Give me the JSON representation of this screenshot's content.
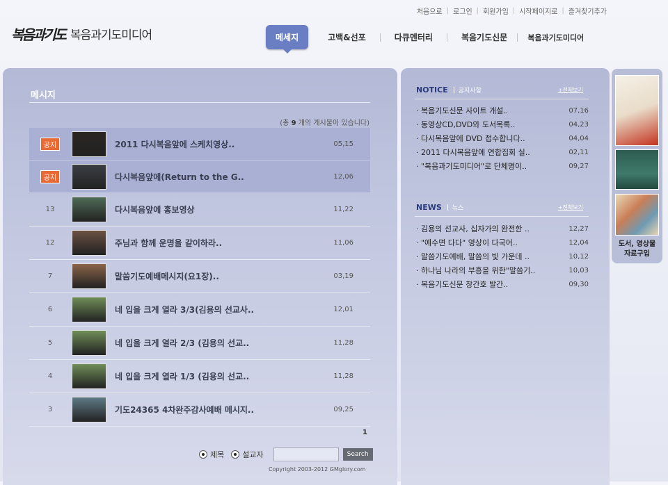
{
  "utility_nav": [
    "처음으로",
    "로그인",
    "회원가입",
    "시작페이지로",
    "즐겨찾기추가"
  ],
  "logo": {
    "mark": "복음과기도",
    "name": "복음과기도미디어"
  },
  "main_nav": {
    "active": "메세지",
    "items": [
      "고백&선포",
      "다큐멘터리",
      "복음기도신문",
      "복음과기도미디어"
    ]
  },
  "board": {
    "title": "메시지",
    "count_prefix": "(총",
    "count": "9",
    "count_suffix": "개의 게시물이 있습니다)",
    "rows": [
      {
        "num": "공지",
        "notice": true,
        "title": "2011 다시복음앞에 스케치영상..",
        "date": "05,15",
        "thumb_color": "#2a2622"
      },
      {
        "num": "공지",
        "notice": true,
        "title": "다시복음앞에(Return to the G..",
        "date": "12,06",
        "thumb_color": "#3b3f44"
      },
      {
        "num": "13",
        "notice": false,
        "title": "다시복음앞에 홍보영상",
        "date": "11,22",
        "thumb_color": "#4e6b57"
      },
      {
        "num": "12",
        "notice": false,
        "title": "주님과 함께 운명을 같이하라..",
        "date": "11,06",
        "thumb_color": "#6a5142"
      },
      {
        "num": "7",
        "notice": false,
        "title": "말씀기도예배메시지(요1장)..",
        "date": "03,19",
        "thumb_color": "#8a6449"
      },
      {
        "num": "6",
        "notice": false,
        "title": "네 입을 크게 열라 3/3(김용의 선교사..",
        "date": "12,01",
        "thumb_color": "#6f8d57"
      },
      {
        "num": "5",
        "notice": false,
        "title": "네 입을 크게 열라 2/3 (김용의 선교..",
        "date": "11,28",
        "thumb_color": "#6f8d57"
      },
      {
        "num": "4",
        "notice": false,
        "title": "네 입을 크게 열라 1/3 (김용의 선교..",
        "date": "11,28",
        "thumb_color": "#6f8d57"
      },
      {
        "num": "3",
        "notice": false,
        "title": "기도24365 4차완주감사예배 메시지..",
        "date": "09,25",
        "thumb_color": "#5f7a86"
      }
    ],
    "page": "1",
    "search": {
      "option_title": "제목",
      "option_preacher": "설교자",
      "button": "Search"
    },
    "copyright": "Copyright 2003-2012 GMglory.com"
  },
  "notice": {
    "title": "NOTICE",
    "subtitle": "공지사항",
    "more": "+전체보기",
    "items": [
      {
        "text": "· 복음기도신문 사이트 개설..",
        "date": "07,16"
      },
      {
        "text": "· 동영상CD,DVD와 도서목록..",
        "date": "04,23"
      },
      {
        "text": "· 다시복음앞에 DVD 접수합니다..",
        "date": "04,04"
      },
      {
        "text": "· 2011 다시복음앞에 연합집회 실..",
        "date": "02,11"
      },
      {
        "text": "· \"복음과기도미디어\"로 단체명이..",
        "date": "09,27"
      }
    ]
  },
  "news": {
    "title": "NEWS",
    "subtitle": "뉴스",
    "more": "+전체보기",
    "items": [
      {
        "text": "· 김용의 선교사, 십자가의 완전한 ..",
        "date": "12,27"
      },
      {
        "text": "· \"예수면 다다\" 영상이 다국어..",
        "date": "12,04"
      },
      {
        "text": "· 말씀기도예배, 말씀의 빛 가운데 ..",
        "date": "10,12"
      },
      {
        "text": "· 하나님 나라의 부흥을 위한\"말씀기..",
        "date": "10,03"
      },
      {
        "text": "· 복음기도신문 창간호 발간..",
        "date": "09,30"
      }
    ]
  },
  "side_banner": {
    "label_line1": "도서, 영상물",
    "label_line2": "자료구입"
  },
  "colors": {
    "nav_active": "#6a7ec4",
    "notice_badge": "#e86a35",
    "section_title": "#2a3a7c"
  }
}
